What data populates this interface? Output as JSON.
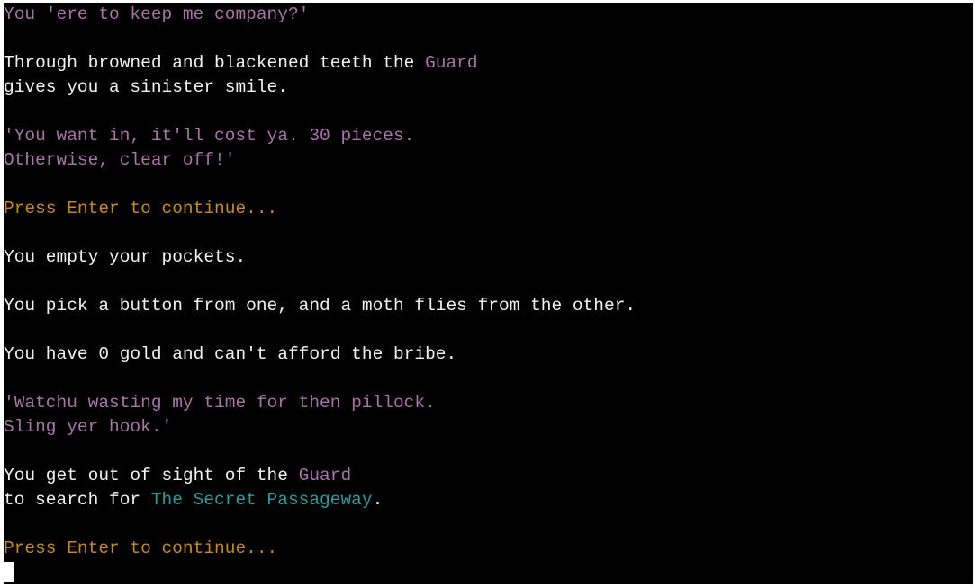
{
  "colors": {
    "background": "#000000",
    "text": "#f2f2f2",
    "dialogue": "#a774a8",
    "prompt": "#c8891b",
    "location": "#2a9d9d"
  },
  "terminal": {
    "lines": [
      [
        {
          "t": "You 'ere to keep me company?'",
          "c": "dialogue"
        }
      ],
      [],
      [
        {
          "t": "Through browned and blackened teeth the ",
          "c": "text"
        },
        {
          "t": "Guard",
          "c": "dialogue"
        }
      ],
      [
        {
          "t": "gives you a sinister smile.",
          "c": "text"
        }
      ],
      [],
      [
        {
          "t": "'You want in, it'll cost ya. 30 pieces.",
          "c": "dialogue"
        }
      ],
      [
        {
          "t": "Otherwise, clear off!'",
          "c": "dialogue"
        }
      ],
      [],
      [
        {
          "t": "Press Enter to continue...",
          "c": "prompt"
        }
      ],
      [],
      [
        {
          "t": "You empty your pockets.",
          "c": "text"
        }
      ],
      [],
      [
        {
          "t": "You pick a button from one, and a moth flies from the other.",
          "c": "text"
        }
      ],
      [],
      [
        {
          "t": "You have 0 gold and can't afford the bribe.",
          "c": "text"
        }
      ],
      [],
      [
        {
          "t": "'Watchu wasting my time for then pillock.",
          "c": "dialogue"
        }
      ],
      [
        {
          "t": "Sling yer hook.'",
          "c": "dialogue"
        }
      ],
      [],
      [
        {
          "t": "You get out of sight of the ",
          "c": "text"
        },
        {
          "t": "Guard",
          "c": "dialogue"
        }
      ],
      [
        {
          "t": "to search for ",
          "c": "text"
        },
        {
          "t": "The Secret Passageway",
          "c": "location"
        },
        {
          "t": ".",
          "c": "text"
        }
      ],
      [],
      [
        {
          "t": "Press Enter to continue...",
          "c": "prompt"
        }
      ]
    ],
    "cursor": "block-cursor"
  }
}
